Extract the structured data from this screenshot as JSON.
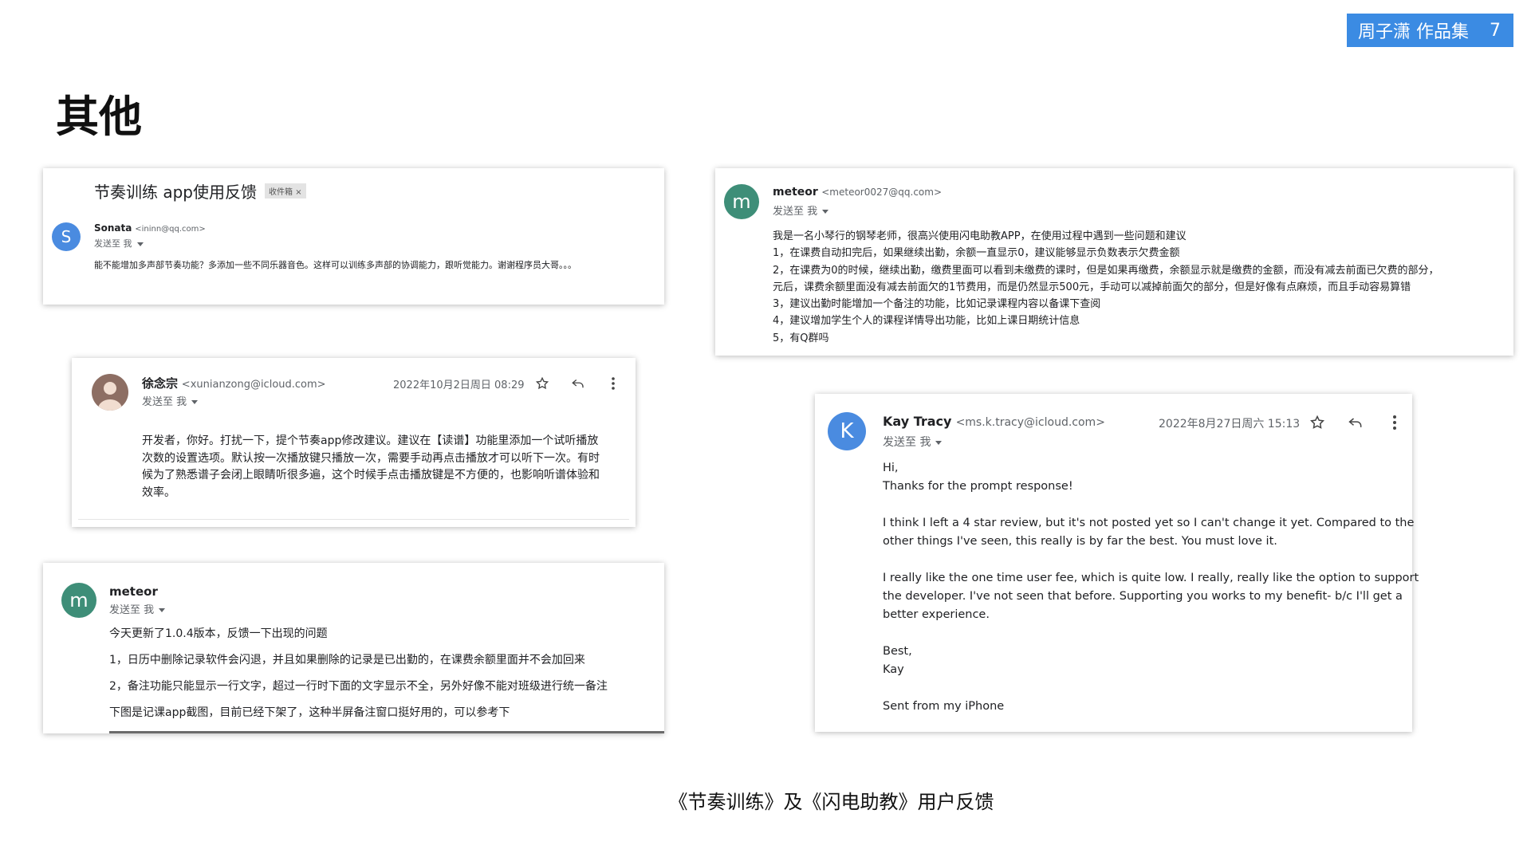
{
  "badge": {
    "title": "周子潇 作品集",
    "page_no": "7"
  },
  "page_title": "其他",
  "caption": "《节奏训练》及《闪电助教》用户反馈",
  "card_a": {
    "subject": "节奏训练 app使用反馈",
    "label": "收件箱 ×",
    "avatar": "S",
    "sender": "Sonata",
    "address": "<ininn@qq.com>",
    "to": "发送至 我",
    "body": "能不能增加多声部节奏功能？多添加一些不同乐器音色。这样可以训练多声部的协调能力，跟听觉能力。谢谢程序员大哥。。。"
  },
  "card_b": {
    "sender": "徐念宗",
    "address": "<xunianzong@icloud.com>",
    "date": "2022年10月2日周日 08:29",
    "to": "发送至 我",
    "body": [
      "开发者，你好。打扰一下，提个节奏app修改建议。建议在【读谱】功能里添加一个试听播放",
      "次数的设置选项。默认按一次播放键只播放一次，需要手动再点击播放才可以听下一次。有时",
      "候为了熟悉谱子会闭上眼睛听很多遍，这个时候手点击播放键是不方便的，也影响听谱体验和",
      "效率。"
    ]
  },
  "card_c": {
    "avatar": "m",
    "sender": "meteor",
    "to": "发送至 我",
    "body": [
      "今天更新了1.0.4版本，反馈一下出现的问题",
      "1，日历中删除记录软件会闪退，并且如果删除的记录是已出勤的，在课费余额里面并不会加回来",
      "2，备注功能只能显示一行文字，超过一行时下面的文字显示不全，另外好像不能对班级进行统一备注",
      "下图是记课app截图，目前已经下架了，这种半屏备注窗口挺好用的，可以参考下"
    ]
  },
  "card_d": {
    "avatar": "m",
    "sender": "meteor",
    "address": "<meteor0027@qq.com>",
    "to": "发送至 我",
    "body": [
      "我是一名小琴行的钢琴老师，很高兴使用闪电助教APP，在使用过程中遇到一些问题和建议",
      "1，在课费自动扣完后，如果继续出勤，余额一直显示0，建议能够显示负数表示欠费金额",
      "2，在课费为0的时候，继续出勤，缴费里面可以看到未缴费的课时，但是如果再缴费，余额显示就是缴费的金额，而没有减去前面已欠费的部分，",
      "元后，课费余额里面没有减去前面欠的1节费用，而是仍然显示500元，手动可以减掉前面欠的部分，但是好像有点麻烦，而且手动容易算错",
      "3，建议出勤时能增加一个备注的功能，比如记录课程内容以备课下查阅",
      "4，建议增加学生个人的课程详情导出功能，比如上课日期统计信息",
      "5，有Q群吗"
    ]
  },
  "card_e": {
    "avatar": "K",
    "sender": "Kay Tracy",
    "address": "<ms.k.tracy@icloud.com>",
    "date": "2022年8月27日周六 15:13",
    "to": "发送至 我",
    "body": [
      "Hi,",
      "Thanks for the prompt response!",
      "I think I left a 4 star review, but it's not posted yet so I can't change it yet. Compared to the",
      "other things I've seen, this really is by far the best. You must love it.",
      "I really like the one time user fee, which is quite low. I really, really like the option to support",
      "the developer. I've not seen that before.  Supporting you works to my benefit- b/c I'll get a",
      "better experience.",
      "Best,",
      "Kay",
      "Sent from my iPhone"
    ]
  },
  "colors": {
    "badge": "#3b8be3",
    "avatar_blue": "#4a8be0",
    "avatar_green": "#3e8e78",
    "avatar_brown": "#8d6e63"
  },
  "icons": [
    "star-icon",
    "reply-icon",
    "more-vert-icon"
  ]
}
